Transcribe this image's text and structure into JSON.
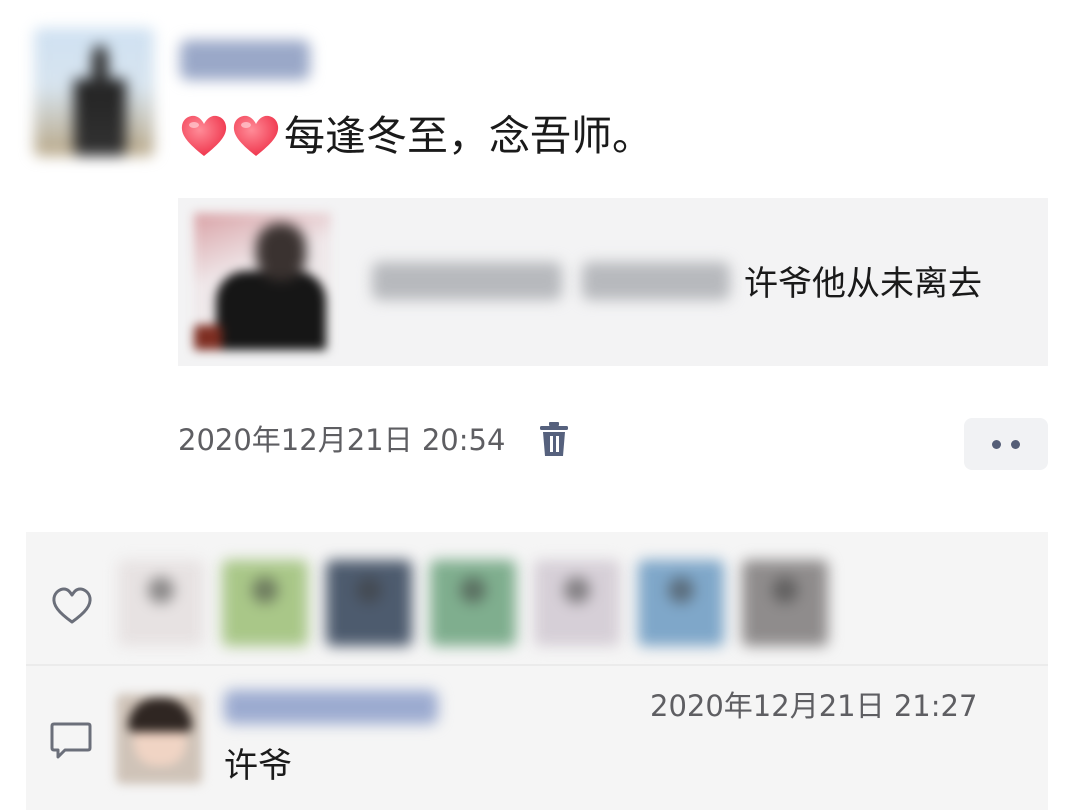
{
  "post": {
    "author_name": "",
    "text": "每逢冬至，念吾师。",
    "emoji": [
      "red-heart",
      "red-heart"
    ],
    "share": {
      "title": "许爷他从未离去"
    },
    "timestamp": "2020年12月21日 20:54"
  },
  "interactions": {
    "likers_count_visible": 7,
    "likers": [
      {
        "tone": "#e7e2e2"
      },
      {
        "tone": "#a9c788"
      },
      {
        "tone": "#4d5b6e"
      },
      {
        "tone": "#7fae8e"
      },
      {
        "tone": "#d6cfd7"
      },
      {
        "tone": "#7fa7c9"
      },
      {
        "tone": "#8f8c8c"
      }
    ],
    "comments": [
      {
        "author_name": "",
        "time": "2020年12月21日 21:27",
        "text": "许爷"
      }
    ]
  },
  "colors": {
    "background": "#ffffff",
    "panel": "#f5f5f5",
    "link_name": "#576b95",
    "muted_text": "#5e5e62",
    "heart": "#ff5168"
  },
  "icons": [
    "trash-icon",
    "more-dots-icon",
    "heart-outline-icon",
    "comment-icon"
  ]
}
